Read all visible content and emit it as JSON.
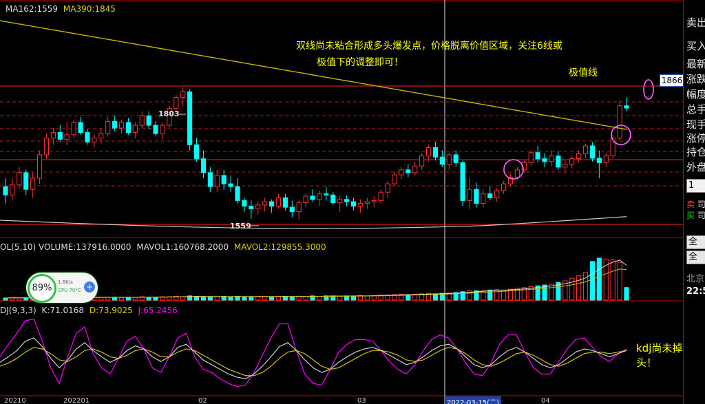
{
  "main_panel": {
    "ma162_label": "MA162:1559",
    "ma390_label": "MA390:1845",
    "annotation_line1": "双线尚未粘合形成多头爆发点，价格脱离价值区域，关注6线或",
    "annotation_line2": "极值下的调整即可！",
    "annotation_extreme": "极值线",
    "high_label": "1803",
    "low_label": "1559",
    "price_tag": "1866"
  },
  "volume_panel": {
    "header": "OL(5,10) VOLUME:137916.0000",
    "mavol1": "MAVOL1:160768.2000",
    "mavol2": "MAVOL2:129855.3000"
  },
  "kdj_panel": {
    "header": "DJ(9,3,3)",
    "k_label": "K:71.0168",
    "d_label": "D:73.9025",
    "j_label": "J:65.2456",
    "annotation": "kdj尚未掉",
    "annotation2": "头！"
  },
  "axis_labels": {
    "x1": "20210",
    "x2": "202201",
    "x3": "02",
    "x4": "03",
    "x5": "2022-03-15(二)",
    "x6": "04"
  },
  "sidebar": {
    "items": [
      "卖出",
      "买入",
      "最新",
      "涨跌",
      "幅度",
      "总手",
      "现手",
      "涨停",
      "持仓",
      "外盘"
    ],
    "box_value": "1",
    "sell_label": "卖",
    "buy_label": "买",
    "sell_value": "司",
    "buy_value": "司",
    "btn1": "全",
    "btn2": "全",
    "location": "北京",
    "time": "22:5"
  },
  "cpu_widget": {
    "percent": "89%",
    "speed": "1.6K/s",
    "cpu_temp": "CPU 70°C",
    "plus": "+"
  },
  "colors": {
    "up": "#ff3232",
    "down": "#00ffff",
    "ma_yellow": "#c8b400",
    "ma_white": "#c8c8c8",
    "k_white": "#d0d0d0",
    "d_yellow": "#d4c000",
    "j_magenta": "#ff00ff",
    "annotation": "#ffff00",
    "circle": "#ff66ff"
  },
  "chart_data": {
    "type": "candlestick",
    "price_levels": [
      1866,
      1803,
      1559
    ],
    "candles": [
      [
        1625,
        1640,
        1595,
        1610
      ],
      [
        1610,
        1640,
        1600,
        1628
      ],
      [
        1628,
        1660,
        1620,
        1650
      ],
      [
        1650,
        1655,
        1610,
        1620
      ],
      [
        1620,
        1650,
        1605,
        1640
      ],
      [
        1640,
        1690,
        1630,
        1682
      ],
      [
        1682,
        1720,
        1675,
        1712
      ],
      [
        1712,
        1730,
        1700,
        1722
      ],
      [
        1722,
        1735,
        1705,
        1710
      ],
      [
        1710,
        1740,
        1700,
        1718
      ],
      [
        1718,
        1745,
        1712,
        1740
      ],
      [
        1740,
        1750,
        1718,
        1722
      ],
      [
        1722,
        1728,
        1700,
        1705
      ],
      [
        1705,
        1720,
        1695,
        1712
      ],
      [
        1712,
        1730,
        1702,
        1720
      ],
      [
        1720,
        1750,
        1715,
        1742
      ],
      [
        1742,
        1752,
        1725,
        1730
      ],
      [
        1730,
        1745,
        1720,
        1740
      ],
      [
        1740,
        1748,
        1718,
        1722
      ],
      [
        1722,
        1740,
        1712,
        1735
      ],
      [
        1735,
        1760,
        1730,
        1752
      ],
      [
        1752,
        1760,
        1728,
        1735
      ],
      [
        1735,
        1742,
        1715,
        1720
      ],
      [
        1720,
        1740,
        1710,
        1735
      ],
      [
        1735,
        1770,
        1730,
        1765
      ],
      [
        1765,
        1790,
        1755,
        1785
      ],
      [
        1785,
        1803,
        1770,
        1795
      ],
      [
        1795,
        1800,
        1690,
        1700
      ],
      [
        1700,
        1712,
        1670,
        1675
      ],
      [
        1675,
        1690,
        1640,
        1650
      ],
      [
        1650,
        1660,
        1615,
        1625
      ],
      [
        1625,
        1655,
        1615,
        1645
      ],
      [
        1645,
        1655,
        1620,
        1630
      ],
      [
        1630,
        1645,
        1615,
        1625
      ],
      [
        1625,
        1640,
        1595,
        1600
      ],
      [
        1600,
        1605,
        1580,
        1590
      ],
      [
        1590,
        1600,
        1568,
        1585
      ],
      [
        1585,
        1598,
        1575,
        1592
      ],
      [
        1592,
        1605,
        1580,
        1598
      ],
      [
        1598,
        1602,
        1578,
        1590
      ],
      [
        1590,
        1612,
        1585,
        1605
      ],
      [
        1605,
        1612,
        1582,
        1588
      ],
      [
        1588,
        1600,
        1570,
        1580
      ],
      [
        1580,
        1600,
        1565,
        1596
      ],
      [
        1596,
        1612,
        1588,
        1608
      ],
      [
        1608,
        1620,
        1598,
        1602
      ],
      [
        1602,
        1618,
        1590,
        1612
      ],
      [
        1612,
        1625,
        1600,
        1610
      ],
      [
        1610,
        1615,
        1592,
        1596
      ],
      [
        1596,
        1608,
        1580,
        1602
      ],
      [
        1602,
        1610,
        1590,
        1598
      ],
      [
        1598,
        1605,
        1582,
        1590
      ],
      [
        1590,
        1602,
        1578,
        1595
      ],
      [
        1595,
        1605,
        1585,
        1598
      ],
      [
        1598,
        1608,
        1588,
        1600
      ],
      [
        1600,
        1620,
        1595,
        1615
      ],
      [
        1615,
        1635,
        1605,
        1630
      ],
      [
        1630,
        1652,
        1625,
        1646
      ],
      [
        1646,
        1660,
        1638,
        1655
      ],
      [
        1655,
        1665,
        1642,
        1650
      ],
      [
        1650,
        1670,
        1645,
        1662
      ],
      [
        1662,
        1685,
        1655,
        1680
      ],
      [
        1680,
        1700,
        1670,
        1695
      ],
      [
        1695,
        1705,
        1672,
        1678
      ],
      [
        1678,
        1690,
        1660,
        1665
      ],
      [
        1665,
        1685,
        1655,
        1682
      ],
      [
        1682,
        1690,
        1660,
        1668
      ],
      [
        1668,
        1672,
        1590,
        1600
      ],
      [
        1600,
        1640,
        1585,
        1620
      ],
      [
        1620,
        1632,
        1588,
        1595
      ],
      [
        1595,
        1620,
        1588,
        1612
      ],
      [
        1612,
        1625,
        1600,
        1605
      ],
      [
        1605,
        1622,
        1598,
        1618
      ],
      [
        1618,
        1635,
        1612,
        1630
      ],
      [
        1630,
        1648,
        1625,
        1642
      ],
      [
        1642,
        1660,
        1636,
        1655
      ],
      [
        1655,
        1672,
        1650,
        1668
      ],
      [
        1668,
        1690,
        1662,
        1686
      ],
      [
        1686,
        1698,
        1668,
        1675
      ],
      [
        1675,
        1685,
        1660,
        1670
      ],
      [
        1670,
        1690,
        1662,
        1680
      ],
      [
        1680,
        1688,
        1655,
        1660
      ],
      [
        1660,
        1672,
        1650,
        1665
      ],
      [
        1665,
        1680,
        1658,
        1675
      ],
      [
        1675,
        1690,
        1668,
        1684
      ],
      [
        1684,
        1702,
        1676,
        1698
      ],
      [
        1698,
        1705,
        1670,
        1676
      ],
      [
        1676,
        1690,
        1640,
        1668
      ],
      [
        1668,
        1685,
        1660,
        1680
      ],
      [
        1680,
        1718,
        1675,
        1712
      ],
      [
        1712,
        1780,
        1708,
        1770
      ],
      [
        1770,
        1785,
        1760,
        1766
      ]
    ],
    "volumes": [
      5,
      6,
      5,
      6,
      7,
      7,
      8,
      7,
      6,
      6,
      7,
      6,
      6,
      7,
      6,
      7,
      7,
      6,
      7,
      6,
      8,
      7,
      7,
      8,
      8,
      9,
      8,
      10,
      9,
      8,
      8,
      8,
      9,
      8,
      9,
      8,
      8,
      9,
      9,
      8,
      9,
      9,
      8,
      9,
      9,
      10,
      9,
      10,
      10,
      9,
      10,
      10,
      11,
      10,
      11,
      12,
      12,
      13,
      14,
      13,
      14,
      15,
      16,
      15,
      16,
      17,
      18,
      20,
      22,
      22,
      23,
      24,
      25,
      24,
      26,
      28,
      30,
      32,
      34,
      36,
      38,
      42,
      46,
      52,
      58,
      66,
      92,
      100,
      98,
      96,
      90,
      30
    ],
    "kdj_k": [
      55,
      62,
      70,
      82,
      86,
      75,
      60,
      48,
      58,
      72,
      80,
      70,
      62,
      55,
      60,
      70,
      76,
      72,
      62,
      56,
      62,
      74,
      78,
      68,
      58,
      52,
      46,
      40,
      36,
      34,
      40,
      50,
      62,
      75,
      80,
      70,
      58,
      48,
      42,
      46,
      55,
      62,
      68,
      72,
      74,
      70,
      64,
      58,
      52,
      55,
      62,
      70,
      76,
      78,
      72,
      62,
      52,
      48,
      52,
      62,
      70,
      74,
      68,
      60,
      52,
      48,
      52,
      60,
      68,
      72,
      70,
      66,
      62,
      66,
      70
    ],
    "kdj_d": [
      50,
      54,
      60,
      68,
      74,
      72,
      66,
      58,
      56,
      62,
      70,
      72,
      68,
      62,
      60,
      64,
      70,
      72,
      68,
      62,
      62,
      68,
      72,
      70,
      64,
      58,
      52,
      46,
      42,
      38,
      38,
      42,
      50,
      60,
      68,
      70,
      66,
      58,
      50,
      46,
      48,
      54,
      60,
      66,
      70,
      70,
      68,
      64,
      58,
      56,
      58,
      64,
      70,
      74,
      72,
      66,
      58,
      52,
      50,
      54,
      60,
      66,
      68,
      64,
      58,
      52,
      50,
      54,
      60,
      66,
      68,
      68,
      66,
      68,
      70
    ],
    "kdj_j": [
      62,
      78,
      92,
      108,
      110,
      82,
      48,
      28,
      62,
      92,
      100,
      66,
      48,
      40,
      60,
      82,
      88,
      72,
      48,
      42,
      62,
      86,
      92,
      62,
      46,
      42,
      34,
      28,
      24,
      26,
      42,
      64,
      86,
      104,
      104,
      70,
      40,
      28,
      26,
      46,
      68,
      78,
      84,
      84,
      82,
      70,
      56,
      46,
      40,
      52,
      70,
      84,
      90,
      86,
      72,
      54,
      40,
      38,
      54,
      78,
      90,
      90,
      68,
      48,
      40,
      40,
      56,
      72,
      84,
      86,
      74,
      62,
      56,
      66,
      72
    ]
  }
}
